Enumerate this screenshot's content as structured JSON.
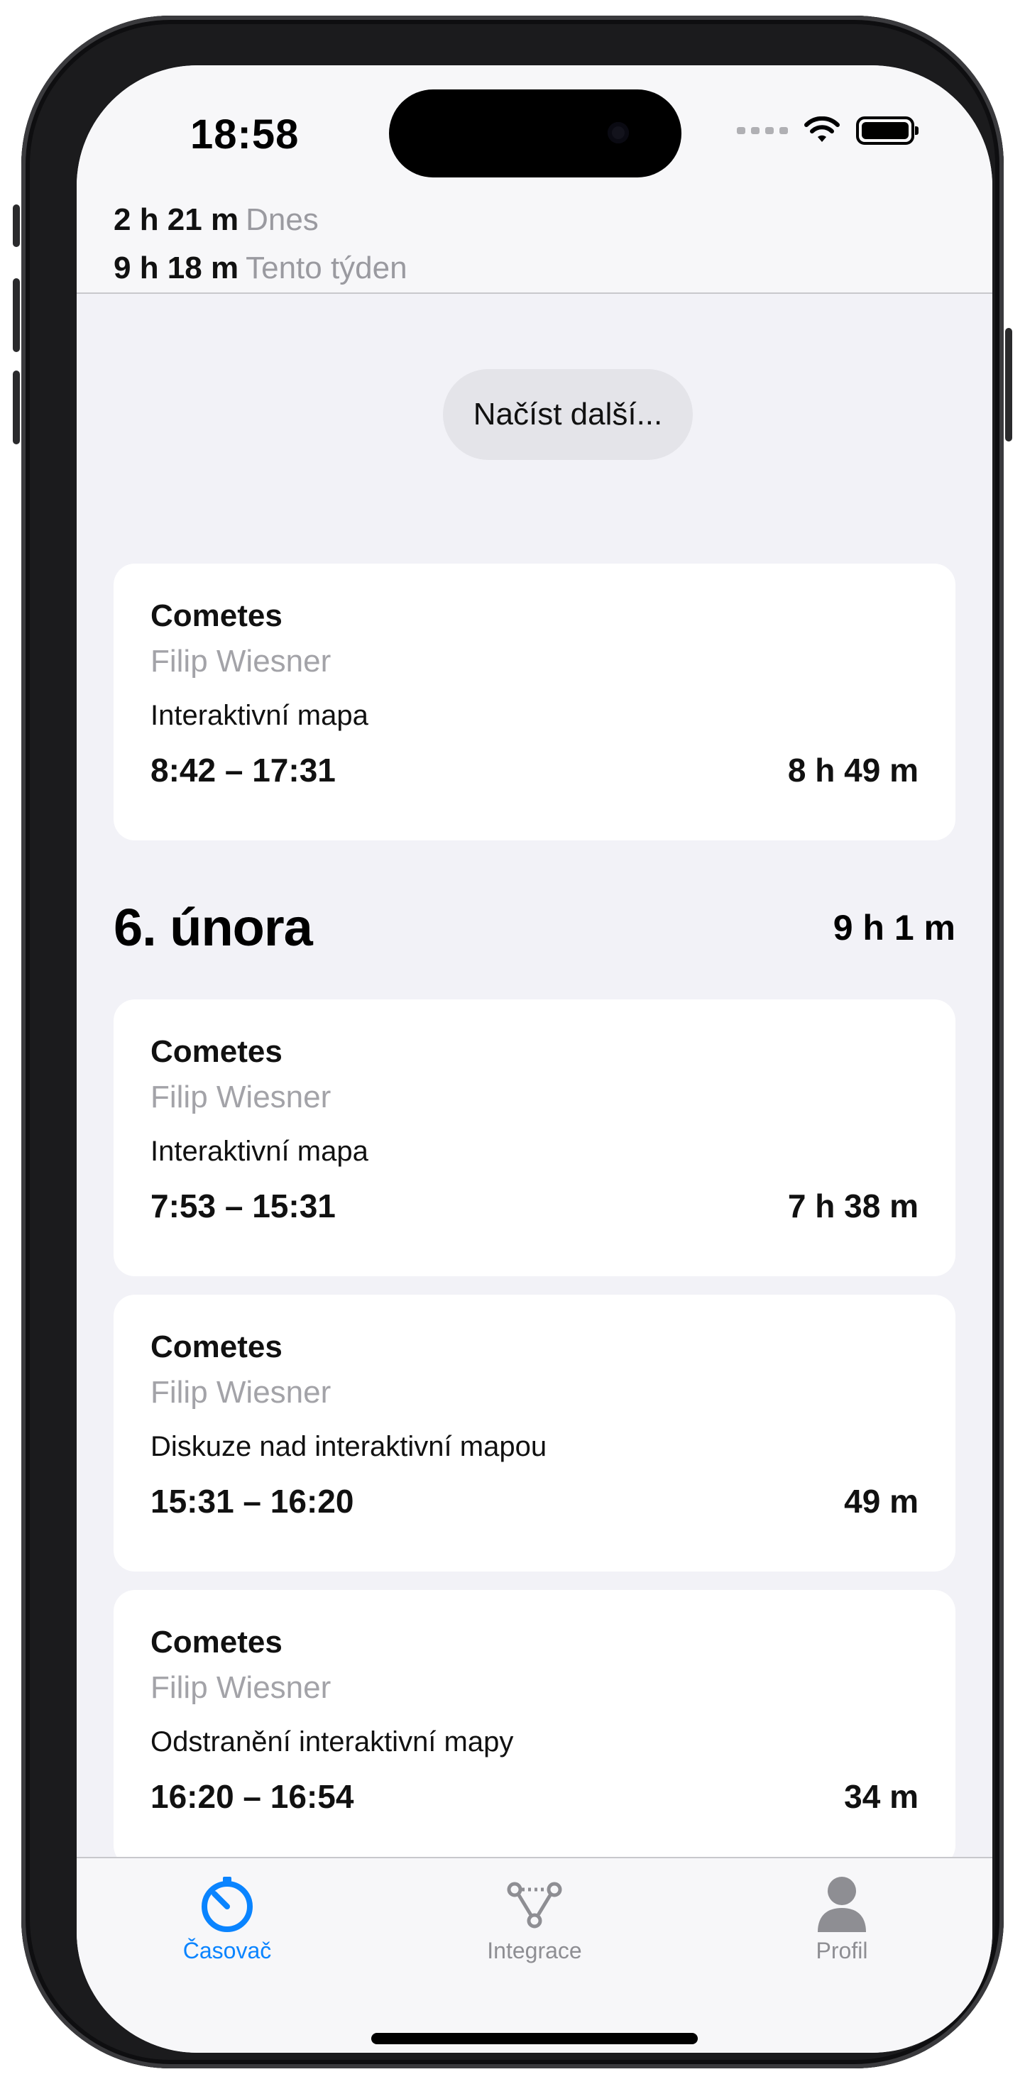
{
  "status_bar": {
    "time": "18:58"
  },
  "totals": {
    "today_value": "2 h 21 m",
    "today_label": "Dnes",
    "week_value": "9 h 18 m",
    "week_label": "Tento týden"
  },
  "load_more_label": "Načíst další...",
  "entries_top": [
    {
      "project": "Cometes",
      "person": "Filip Wiesner",
      "description": "Interaktivní mapa",
      "time_range": "8:42 – 17:31",
      "duration": "8 h 49 m"
    }
  ],
  "day_group": {
    "title": "6. února",
    "total": "9 h 1 m",
    "entries": [
      {
        "project": "Cometes",
        "person": "Filip Wiesner",
        "description": "Interaktivní mapa",
        "time_range": "7:53 – 15:31",
        "duration": "7 h 38 m"
      },
      {
        "project": "Cometes",
        "person": "Filip Wiesner",
        "description": "Diskuze nad interaktivní mapou",
        "time_range": "15:31 – 16:20",
        "duration": "49 m"
      },
      {
        "project": "Cometes",
        "person": "Filip Wiesner",
        "description": "Odstranění interaktivní mapy",
        "time_range": "16:20 – 16:54",
        "duration": "34 m"
      }
    ]
  },
  "tabbar": {
    "tabs": [
      {
        "label": "Časovač",
        "icon": "timer-icon",
        "active": true
      },
      {
        "label": "Integrace",
        "icon": "integration-icon",
        "active": false
      },
      {
        "label": "Profil",
        "icon": "person-icon",
        "active": false
      }
    ],
    "active_color": "#0a84ff",
    "inactive_color": "#8e8e93"
  }
}
